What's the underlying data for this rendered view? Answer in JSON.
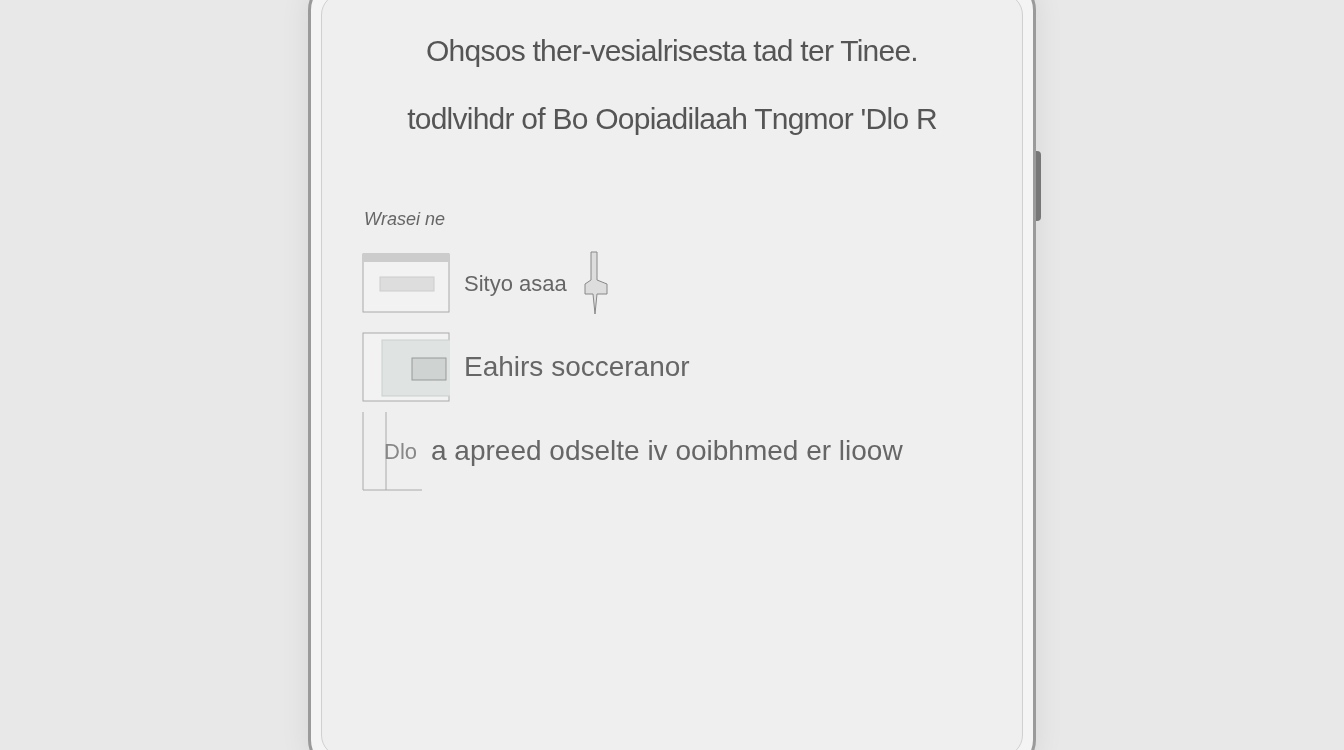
{
  "screen": {
    "title_lines": [
      "Ohqsos ther-vesialrisesta tad ter Tinee.",
      "todlvihdr of Bo Oopiadilaah Tngmor 'Dlo R"
    ],
    "section_label": "Wrasei ne",
    "items": [
      {
        "kind": "app",
        "label": "Sityo asaa"
      },
      {
        "kind": "window",
        "label": "Eahirs socceranor"
      },
      {
        "kind": "note",
        "prefix": "Dlo",
        "label": "a apreed odselte iv ooibhmed er lioow"
      }
    ]
  }
}
